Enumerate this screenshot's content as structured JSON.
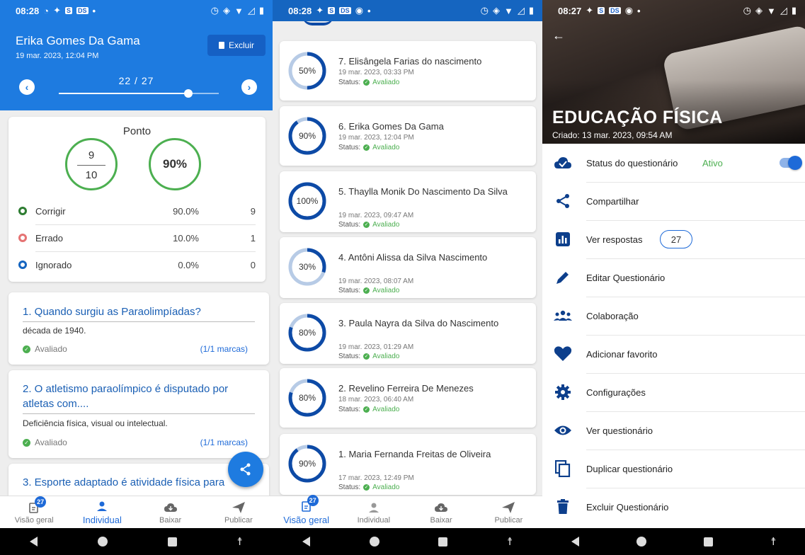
{
  "status_bars": {
    "p1_time": "08:28",
    "p2_time": "08:28",
    "p3_time": "08:27",
    "badge_ds": "DS",
    "badge_s": "S"
  },
  "individual": {
    "student_name": "Erika Gomes Da Gama",
    "date": "19 mar. 2023, 12:04 PM",
    "delete_label": "Excluir",
    "counter": "22 / 27",
    "slider_fraction": 0.81,
    "score": {
      "title": "Ponto",
      "numerator": "9",
      "denominator": "10",
      "percent": "90%",
      "legend": [
        {
          "label": "Corrigir",
          "percent": "90.0%",
          "count": "9",
          "color": "#2e7d32"
        },
        {
          "label": "Errado",
          "percent": "10.0%",
          "count": "1",
          "color": "#e57373"
        },
        {
          "label": "Ignorado",
          "percent": "0.0%",
          "count": "0",
          "color": "#1565c0"
        }
      ]
    },
    "questions": [
      {
        "title": "1. Quando surgiu as Paraolimpíadas?",
        "answer": "década de 1940.",
        "status": "Avaliado",
        "marks": "(1/1 marcas)"
      },
      {
        "title": "2. O atletismo paraolímpico é disputado por atletas com....",
        "answer": "Deficiência física, visual ou intelectual.",
        "status": "Avaliado",
        "marks": "(1/1 marcas)"
      },
      {
        "title": "3. Esporte adaptado é atividade física para"
      }
    ]
  },
  "bottom_nav": {
    "badge": "27",
    "items": [
      {
        "label": "Visão geral"
      },
      {
        "label": "Individual"
      },
      {
        "label": "Baixar"
      },
      {
        "label": "Publicar"
      }
    ]
  },
  "attempts": {
    "status_label": "Status:",
    "items": [
      {
        "name": "7. Elisângela Farias do nascimento",
        "date": "19 mar. 2023, 03:33 PM",
        "status": "Avaliado",
        "percent": "50%",
        "value": 50
      },
      {
        "name": "6. Erika Gomes Da Gama",
        "date": "19 mar. 2023, 12:04 PM",
        "status": "Avaliado",
        "percent": "90%",
        "value": 90
      },
      {
        "name": "5. Thaylla Monik Do Nascimento Da Silva",
        "date": "19 mar. 2023, 09:47 AM",
        "status": "Avaliado",
        "percent": "100%",
        "value": 100
      },
      {
        "name": "4. Antôni Alissa da Silva Nascimento",
        "date": "19 mar. 2023, 08:07 AM",
        "status": "Avaliado",
        "percent": "30%",
        "value": 30
      },
      {
        "name": "3. Paula Nayra da Silva do Nascimento",
        "date": "19 mar. 2023, 01:29 AM",
        "status": "Avaliado",
        "percent": "80%",
        "value": 80
      },
      {
        "name": "2. Revelino Ferreira De Menezes",
        "date": "18 mar. 2023, 06:40 AM",
        "status": "Avaliado",
        "percent": "80%",
        "value": 80
      },
      {
        "name": "1. Maria Fernanda Freitas de Oliveira",
        "date": "17 mar. 2023, 12:49 PM",
        "status": "Avaliado",
        "percent": "90%",
        "value": 90
      }
    ]
  },
  "quiz": {
    "title": "EDUCAÇÃO FÍSICA",
    "created": "Criado: 13 mar. 2023, 09:54 AM",
    "status_label": "Status do questionário",
    "status_value": "Ativo",
    "toggle_on": true,
    "menu": [
      {
        "label": "Compartilhar",
        "icon": "share-icon"
      },
      {
        "label": "Ver respostas",
        "icon": "chart-icon",
        "count": "27"
      },
      {
        "label": "Editar Questionário",
        "icon": "pencil-icon"
      },
      {
        "label": "Colaboração",
        "icon": "people-icon"
      },
      {
        "label": "Adicionar favorito",
        "icon": "heart-icon"
      },
      {
        "label": "Configurações",
        "icon": "gear-icon"
      },
      {
        "label": "Ver questionário",
        "icon": "eye-icon"
      },
      {
        "label": "Duplicar questionário",
        "icon": "copy-icon"
      },
      {
        "label": "Excluir Questionário",
        "icon": "trash-icon"
      }
    ]
  },
  "colors": {
    "primary": "#1e7be0",
    "link_blue": "#1e6ad8",
    "green": "#4caf50",
    "ring_blue": "#0d4aa6",
    "ring_light": "#b7cbe6"
  }
}
